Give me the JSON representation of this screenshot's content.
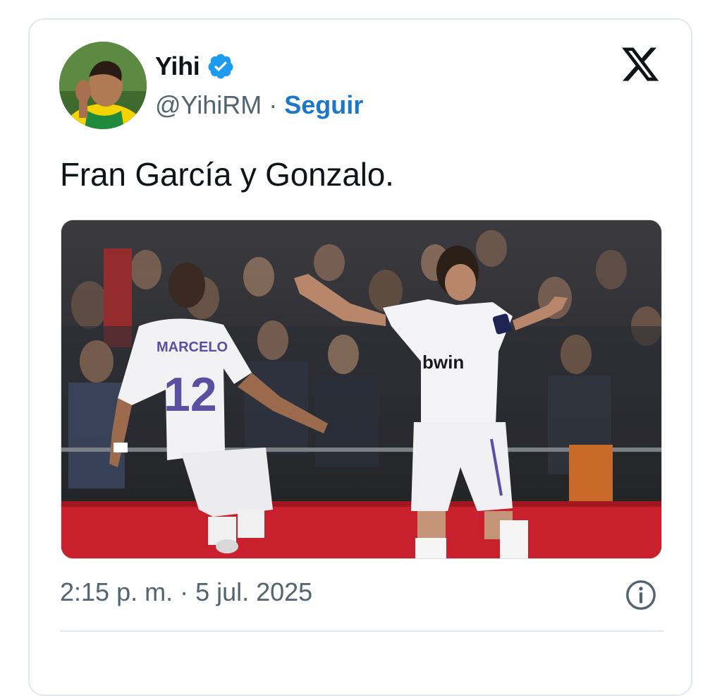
{
  "tweet": {
    "author": {
      "display_name": "Yihi",
      "handle": "@YihiRM",
      "verified": true,
      "follow_label": "Seguir",
      "separator": "·"
    },
    "text": "Fran García y Gonzalo.",
    "timestamp": "2:15 p. m. · 5 jul. 2025",
    "media": {
      "jersey_name": "MARCELO",
      "jersey_number": "12",
      "sponsor": "bwin"
    }
  },
  "colors": {
    "follow": "#1d77c9",
    "verified": "#1d9bf0",
    "muted": "#536471",
    "border": "#e1e8ed",
    "billboard": "#c8202c"
  },
  "icons": {
    "platform_logo": "x-logo-icon",
    "verified": "verified-badge-icon",
    "info": "info-icon"
  }
}
